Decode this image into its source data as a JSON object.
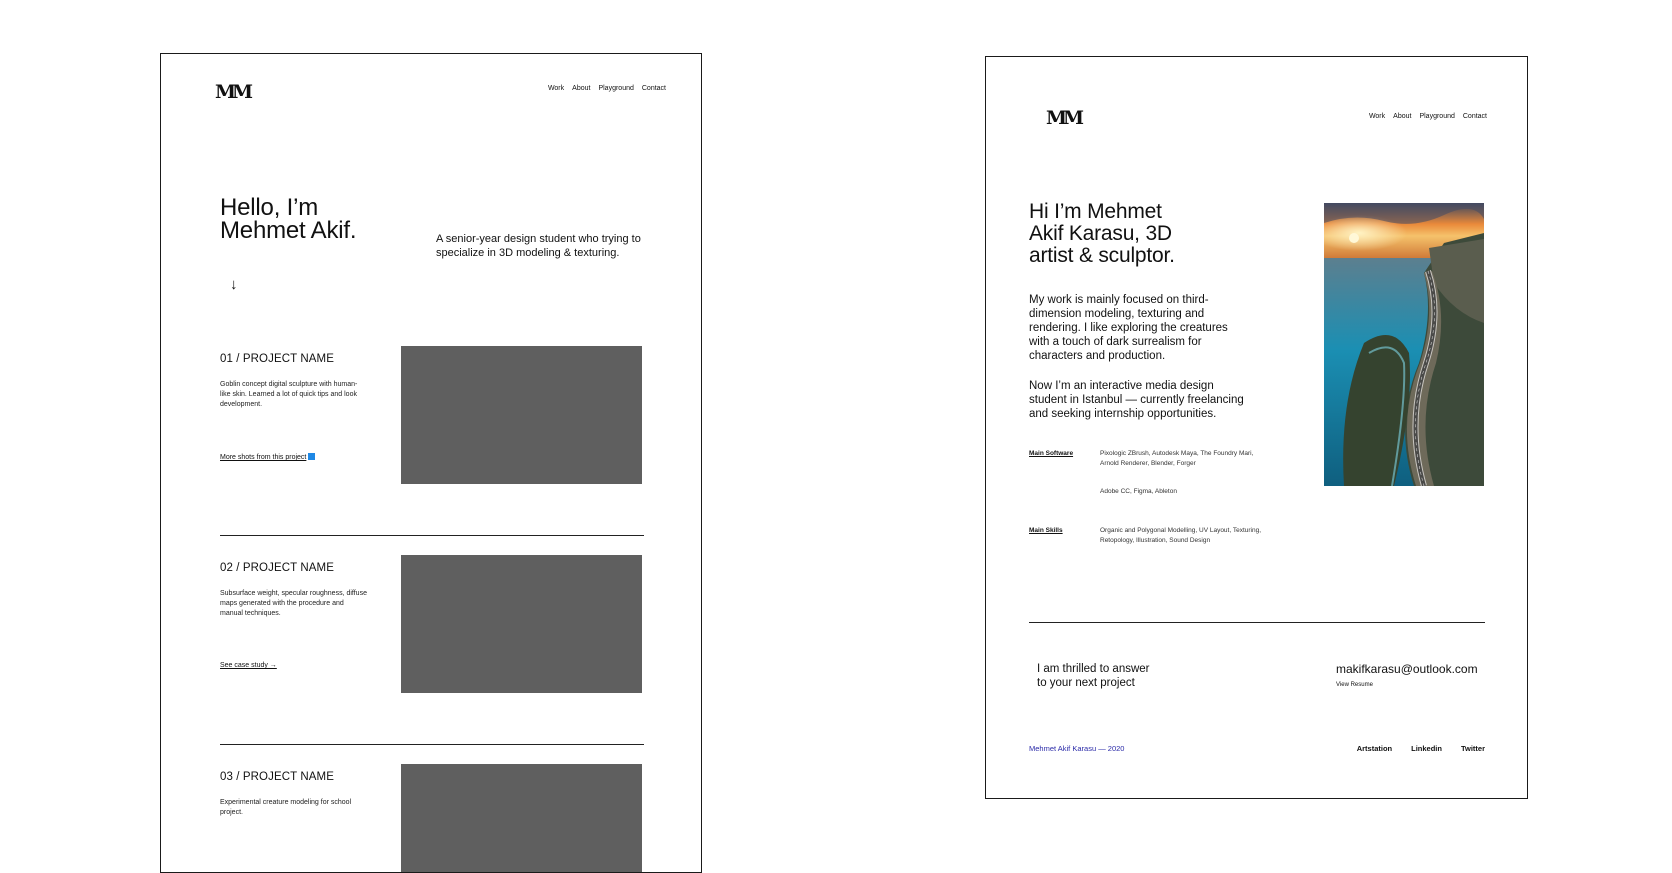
{
  "left_page": {
    "logo_text": "M",
    "nav": [
      "Work",
      "About",
      "Playground",
      "Contact"
    ],
    "hero_line1": "Hello, I’m",
    "hero_line2": "Mehmet Akif.",
    "intro": "A senior-year design student who trying to specialize in 3D modeling & texturing.",
    "scroll_arrow": "↓",
    "projects": [
      {
        "title": "01 / PROJECT NAME",
        "description": "Goblin concept digital sculpture with human-like skin. Learned a lot of quick tips and look development.",
        "link": "More shots from this project",
        "link_icon": "external-link-icon"
      },
      {
        "title": "02 / PROJECT NAME",
        "description": "Subsurface weight, specular roughness, diffuse maps generated with the procedure and manual techniques.",
        "link": "See case study →"
      },
      {
        "title": "03 / PROJECT NAME",
        "description": "Experimental creature modeling for school project."
      }
    ]
  },
  "right_page": {
    "logo_text": "M",
    "nav": [
      "Work",
      "About",
      "Playground",
      "Contact"
    ],
    "hero_line1": "Hi I’m Mehmet",
    "hero_line2": "Akif Karasu, 3D",
    "hero_line3": "artist & sculptor.",
    "para1": "My work is mainly focused on third-dimension modeling, texturing and rendering. I like exploring the creatures with a touch of dark surrealism for characters and production.",
    "para2": "Now I’m an interactive media design student in Istanbul — currently freelancing and seeking internship opportunities.",
    "software_label": "Main Software",
    "software_value1": "Pixologic ZBrush, Autodesk Maya, The Foundry Mari, Arnold Renderer, Blender, Forger",
    "software_value2": "Adobe CC, Figma, Ableton",
    "skills_label": "Main Skills",
    "skills_value": "Organic and Polygonal Modelling, UV Layout, Texturing, Retopology, Illustration, Sound Design",
    "cta_line1": "I am thrilled to answer",
    "cta_line2": "to your next project",
    "email": "makifkarasu@outlook.com",
    "resume_link": "View Resume",
    "copyright": "Mehmet Akif Karasu — 2020",
    "social": [
      "Artstation",
      "Linkedin",
      "Twitter"
    ]
  }
}
